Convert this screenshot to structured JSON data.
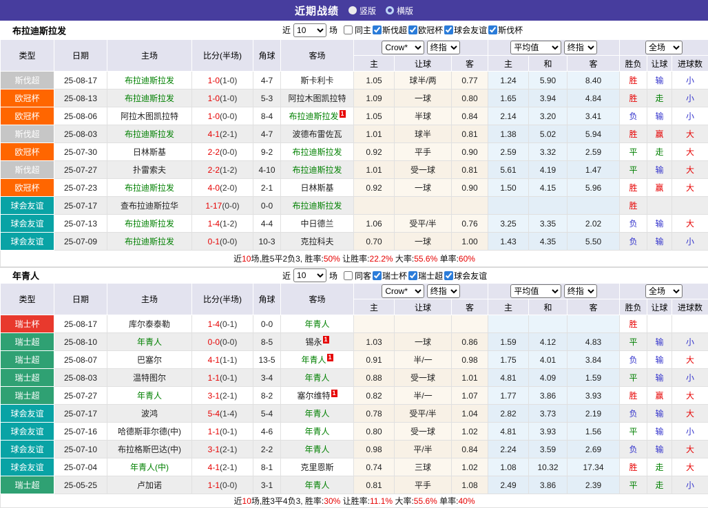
{
  "title_bar": {
    "title": "近期战绩",
    "radio_options": [
      "竖版",
      "横版"
    ],
    "selected_option": "竖版"
  },
  "colors": {
    "titlebar_bg": "#473d9e",
    "accent_red": "#e60000",
    "accent_green": "#008000",
    "accent_blue": "#3333cc",
    "checkbox_blue": "#2b7cd9",
    "header_bg": "#e3e3ef",
    "stripe_gray": "#ededed",
    "odds_col_bg": "#fcf7ee",
    "avg_col_bg": "#eaf4fb",
    "league_colors": {
      "斯伐超": "#c6c6c6",
      "欧冠杯": "#ff6600",
      "球会友谊": "#09a3a5",
      "瑞士杯": "#e8392d",
      "瑞士超": "#2fa173"
    }
  },
  "table_header": {
    "col_type": "类型",
    "col_date": "日期",
    "col_home": "主场",
    "col_score": "比分(半场)",
    "col_corner": "角球",
    "col_away": "客场",
    "odds_source_select": "Crow*",
    "odds_final_select": "终指",
    "avg_select": "平均值",
    "avg_final_select": "终指",
    "scope_select": "全场",
    "sub_cols": [
      "主",
      "让球",
      "客",
      "主",
      "和",
      "客",
      "胜负",
      "让球",
      "进球数"
    ]
  },
  "filter_labels": {
    "near": "近",
    "games": "场",
    "count_value": "10"
  },
  "tables": [
    {
      "team": "布拉迪斯拉发",
      "same_filter": "同主",
      "same_checked": false,
      "league_filters": [
        "斯伐超",
        "欧冠杯",
        "球会友谊",
        "斯伐杯"
      ],
      "rows": [
        {
          "league": "斯伐超",
          "date": "25-08-17",
          "home": "布拉迪斯拉发",
          "home_focus": true,
          "home_mark": "",
          "score": "1-0",
          "half": "(1-0)",
          "corner": "4-7",
          "away": "斯卡利卡",
          "away_focus": false,
          "away_mark": "",
          "odds": [
            "1.05",
            "球半/两",
            "0.77"
          ],
          "avg": [
            "1.24",
            "5.90",
            "8.40"
          ],
          "results": [
            {
              "t": "胜",
              "c": "r"
            },
            {
              "t": "输",
              "c": "b"
            },
            {
              "t": "小",
              "c": "b"
            }
          ]
        },
        {
          "league": "欧冠杯",
          "date": "25-08-13",
          "home": "布拉迪斯拉发",
          "home_focus": true,
          "home_mark": "",
          "score": "1-0",
          "half": "(1-0)",
          "corner": "5-3",
          "away": "阿拉木图凯拉特",
          "away_focus": false,
          "away_mark": "",
          "odds": [
            "1.09",
            "一球",
            "0.80"
          ],
          "avg": [
            "1.65",
            "3.94",
            "4.84"
          ],
          "results": [
            {
              "t": "胜",
              "c": "r"
            },
            {
              "t": "走",
              "c": "g"
            },
            {
              "t": "小",
              "c": "b"
            }
          ]
        },
        {
          "league": "欧冠杯",
          "date": "25-08-06",
          "home": "阿拉木图凯拉特",
          "home_focus": false,
          "home_mark": "",
          "score": "1-0",
          "half": "(0-0)",
          "corner": "8-4",
          "away": "布拉迪斯拉发",
          "away_focus": true,
          "away_mark": "1",
          "odds": [
            "1.05",
            "半球",
            "0.84"
          ],
          "avg": [
            "2.14",
            "3.20",
            "3.41"
          ],
          "results": [
            {
              "t": "负",
              "c": "b"
            },
            {
              "t": "输",
              "c": "b"
            },
            {
              "t": "小",
              "c": "b"
            }
          ]
        },
        {
          "league": "斯伐超",
          "date": "25-08-03",
          "home": "布拉迪斯拉发",
          "home_focus": true,
          "home_mark": "",
          "score": "4-1",
          "half": "(2-1)",
          "corner": "4-7",
          "away": "波德布雷佐瓦",
          "away_focus": false,
          "away_mark": "",
          "odds": [
            "1.01",
            "球半",
            "0.81"
          ],
          "avg": [
            "1.38",
            "5.02",
            "5.94"
          ],
          "results": [
            {
              "t": "胜",
              "c": "r"
            },
            {
              "t": "赢",
              "c": "r"
            },
            {
              "t": "大",
              "c": "r"
            }
          ]
        },
        {
          "league": "欧冠杯",
          "date": "25-07-30",
          "home": "日林斯基",
          "home_focus": false,
          "home_mark": "",
          "score": "2-2",
          "half": "(0-0)",
          "corner": "9-2",
          "away": "布拉迪斯拉发",
          "away_focus": true,
          "away_mark": "",
          "odds": [
            "0.92",
            "平手",
            "0.90"
          ],
          "avg": [
            "2.59",
            "3.32",
            "2.59"
          ],
          "results": [
            {
              "t": "平",
              "c": "g"
            },
            {
              "t": "走",
              "c": "g"
            },
            {
              "t": "大",
              "c": "r"
            }
          ]
        },
        {
          "league": "斯伐超",
          "date": "25-07-27",
          "home": "扑雷索夫",
          "home_focus": false,
          "home_mark": "",
          "score": "2-2",
          "half": "(1-2)",
          "corner": "4-10",
          "away": "布拉迪斯拉发",
          "away_focus": true,
          "away_mark": "",
          "odds": [
            "1.01",
            "受一球",
            "0.81"
          ],
          "avg": [
            "5.61",
            "4.19",
            "1.47"
          ],
          "results": [
            {
              "t": "平",
              "c": "g"
            },
            {
              "t": "输",
              "c": "b"
            },
            {
              "t": "大",
              "c": "r"
            }
          ]
        },
        {
          "league": "欧冠杯",
          "date": "25-07-23",
          "home": "布拉迪斯拉发",
          "home_focus": true,
          "home_mark": "",
          "score": "4-0",
          "half": "(2-0)",
          "corner": "2-1",
          "away": "日林斯基",
          "away_focus": false,
          "away_mark": "",
          "odds": [
            "0.92",
            "一球",
            "0.90"
          ],
          "avg": [
            "1.50",
            "4.15",
            "5.96"
          ],
          "results": [
            {
              "t": "胜",
              "c": "r"
            },
            {
              "t": "赢",
              "c": "r"
            },
            {
              "t": "大",
              "c": "r"
            }
          ]
        },
        {
          "league": "球会友谊",
          "date": "25-07-17",
          "home": "查布拉迪斯拉华",
          "home_focus": false,
          "home_mark": "",
          "score": "1-17",
          "half": "(0-0)",
          "corner": "0-0",
          "away": "布拉迪斯拉发",
          "away_focus": true,
          "away_mark": "",
          "odds": [
            "",
            "",
            ""
          ],
          "avg": [
            "",
            "",
            ""
          ],
          "results": [
            {
              "t": "胜",
              "c": "r"
            },
            {
              "t": "",
              "c": ""
            },
            {
              "t": "",
              "c": ""
            }
          ]
        },
        {
          "league": "球会友谊",
          "date": "25-07-13",
          "home": "布拉迪斯拉发",
          "home_focus": true,
          "home_mark": "",
          "score": "1-4",
          "half": "(1-2)",
          "corner": "4-4",
          "away": "中日德兰",
          "away_focus": false,
          "away_mark": "",
          "odds": [
            "1.06",
            "受平/半",
            "0.76"
          ],
          "avg": [
            "3.25",
            "3.35",
            "2.02"
          ],
          "results": [
            {
              "t": "负",
              "c": "b"
            },
            {
              "t": "输",
              "c": "b"
            },
            {
              "t": "大",
              "c": "r"
            }
          ]
        },
        {
          "league": "球会友谊",
          "date": "25-07-09",
          "home": "布拉迪斯拉发",
          "home_focus": true,
          "home_mark": "",
          "score": "0-1",
          "half": "(0-0)",
          "corner": "10-3",
          "away": "克拉科夫",
          "away_focus": false,
          "away_mark": "",
          "odds": [
            "0.70",
            "一球",
            "1.00"
          ],
          "avg": [
            "1.43",
            "4.35",
            "5.50"
          ],
          "results": [
            {
              "t": "负",
              "c": "b"
            },
            {
              "t": "输",
              "c": "b"
            },
            {
              "t": "小",
              "c": "b"
            }
          ]
        }
      ],
      "summary": [
        {
          "text": "近",
          "red": false
        },
        {
          "text": "10",
          "red": true
        },
        {
          "text": "场,胜5平2负3, 胜率:",
          "red": false
        },
        {
          "text": "50%",
          "red": true
        },
        {
          "text": " 让胜率:",
          "red": false
        },
        {
          "text": "22.2%",
          "red": true
        },
        {
          "text": " 大率:",
          "red": false
        },
        {
          "text": "55.6%",
          "red": true
        },
        {
          "text": " 单率:",
          "red": false
        },
        {
          "text": "60%",
          "red": true
        }
      ]
    },
    {
      "team": "年青人",
      "same_filter": "同客",
      "same_checked": false,
      "league_filters": [
        "瑞士杯",
        "瑞士超",
        "球会友谊"
      ],
      "rows": [
        {
          "league": "瑞士杯",
          "date": "25-08-17",
          "home": "库尔泰泰勒",
          "home_focus": false,
          "home_mark": "",
          "score": "1-4",
          "half": "(0-1)",
          "corner": "0-0",
          "away": "年青人",
          "away_focus": true,
          "away_mark": "",
          "odds": [
            "",
            "",
            ""
          ],
          "avg": [
            "",
            "",
            ""
          ],
          "results": [
            {
              "t": "胜",
              "c": "r"
            },
            {
              "t": "",
              "c": ""
            },
            {
              "t": "",
              "c": ""
            }
          ]
        },
        {
          "league": "瑞士超",
          "date": "25-08-10",
          "home": "年青人",
          "home_focus": true,
          "home_mark": "",
          "score": "0-0",
          "half": "(0-0)",
          "corner": "8-5",
          "away": "锡永",
          "away_focus": false,
          "away_mark": "1",
          "odds": [
            "1.03",
            "一球",
            "0.86"
          ],
          "avg": [
            "1.59",
            "4.12",
            "4.83"
          ],
          "results": [
            {
              "t": "平",
              "c": "g"
            },
            {
              "t": "输",
              "c": "b"
            },
            {
              "t": "小",
              "c": "b"
            }
          ]
        },
        {
          "league": "瑞士超",
          "date": "25-08-07",
          "home": "巴塞尔",
          "home_focus": false,
          "home_mark": "",
          "score": "4-1",
          "half": "(1-1)",
          "corner": "13-5",
          "away": "年青人",
          "away_focus": true,
          "away_mark": "1",
          "odds": [
            "0.91",
            "半/一",
            "0.98"
          ],
          "avg": [
            "1.75",
            "4.01",
            "3.84"
          ],
          "results": [
            {
              "t": "负",
              "c": "b"
            },
            {
              "t": "输",
              "c": "b"
            },
            {
              "t": "大",
              "c": "r"
            }
          ]
        },
        {
          "league": "瑞士超",
          "date": "25-08-03",
          "home": "温特图尔",
          "home_focus": false,
          "home_mark": "",
          "score": "1-1",
          "half": "(0-1)",
          "corner": "3-4",
          "away": "年青人",
          "away_focus": true,
          "away_mark": "",
          "odds": [
            "0.88",
            "受一球",
            "1.01"
          ],
          "avg": [
            "4.81",
            "4.09",
            "1.59"
          ],
          "results": [
            {
              "t": "平",
              "c": "g"
            },
            {
              "t": "输",
              "c": "b"
            },
            {
              "t": "小",
              "c": "b"
            }
          ]
        },
        {
          "league": "瑞士超",
          "date": "25-07-27",
          "home": "年青人",
          "home_focus": true,
          "home_mark": "",
          "score": "3-1",
          "half": "(2-1)",
          "corner": "8-2",
          "away": "塞尔维特",
          "away_focus": false,
          "away_mark": "1",
          "odds": [
            "0.82",
            "半/一",
            "1.07"
          ],
          "avg": [
            "1.77",
            "3.86",
            "3.93"
          ],
          "results": [
            {
              "t": "胜",
              "c": "r"
            },
            {
              "t": "赢",
              "c": "r"
            },
            {
              "t": "大",
              "c": "r"
            }
          ]
        },
        {
          "league": "球会友谊",
          "date": "25-07-17",
          "home": "波鸿",
          "home_focus": false,
          "home_mark": "",
          "score": "5-4",
          "half": "(1-4)",
          "corner": "5-4",
          "away": "年青人",
          "away_focus": true,
          "away_mark": "",
          "odds": [
            "0.78",
            "受平/半",
            "1.04"
          ],
          "avg": [
            "2.82",
            "3.73",
            "2.19"
          ],
          "results": [
            {
              "t": "负",
              "c": "b"
            },
            {
              "t": "输",
              "c": "b"
            },
            {
              "t": "大",
              "c": "r"
            }
          ]
        },
        {
          "league": "球会友谊",
          "date": "25-07-16",
          "home": "哈德斯菲尔德(中)",
          "home_focus": false,
          "home_mark": "",
          "score": "1-1",
          "half": "(0-1)",
          "corner": "4-6",
          "away": "年青人",
          "away_focus": true,
          "away_mark": "",
          "odds": [
            "0.80",
            "受一球",
            "1.02"
          ],
          "avg": [
            "4.81",
            "3.93",
            "1.56"
          ],
          "results": [
            {
              "t": "平",
              "c": "g"
            },
            {
              "t": "输",
              "c": "b"
            },
            {
              "t": "小",
              "c": "b"
            }
          ]
        },
        {
          "league": "球会友谊",
          "date": "25-07-10",
          "home": "布拉格斯巴达(中)",
          "home_focus": false,
          "home_mark": "",
          "score": "3-1",
          "half": "(2-1)",
          "corner": "2-2",
          "away": "年青人",
          "away_focus": true,
          "away_mark": "",
          "odds": [
            "0.98",
            "平/半",
            "0.84"
          ],
          "avg": [
            "2.24",
            "3.59",
            "2.69"
          ],
          "results": [
            {
              "t": "负",
              "c": "b"
            },
            {
              "t": "输",
              "c": "b"
            },
            {
              "t": "大",
              "c": "r"
            }
          ]
        },
        {
          "league": "球会友谊",
          "date": "25-07-04",
          "home": "年青人(中)",
          "home_focus": true,
          "home_mark": "",
          "score": "4-1",
          "half": "(2-1)",
          "corner": "8-1",
          "away": "克里恩斯",
          "away_focus": false,
          "away_mark": "",
          "odds": [
            "0.74",
            "三球",
            "1.02"
          ],
          "avg": [
            "1.08",
            "10.32",
            "17.34"
          ],
          "results": [
            {
              "t": "胜",
              "c": "r"
            },
            {
              "t": "走",
              "c": "g"
            },
            {
              "t": "大",
              "c": "r"
            }
          ]
        },
        {
          "league": "瑞士超",
          "date": "25-05-25",
          "home": "卢加诺",
          "home_focus": false,
          "home_mark": "",
          "score": "1-1",
          "half": "(0-0)",
          "corner": "3-1",
          "away": "年青人",
          "away_focus": true,
          "away_mark": "",
          "odds": [
            "0.81",
            "平手",
            "1.08"
          ],
          "avg": [
            "2.49",
            "3.86",
            "2.39"
          ],
          "results": [
            {
              "t": "平",
              "c": "g"
            },
            {
              "t": "走",
              "c": "g"
            },
            {
              "t": "小",
              "c": "b"
            }
          ]
        }
      ],
      "summary": [
        {
          "text": "近",
          "red": false
        },
        {
          "text": "10",
          "red": true
        },
        {
          "text": "场,胜3平4负3, 胜率:",
          "red": false
        },
        {
          "text": "30%",
          "red": true
        },
        {
          "text": " 让胜率:",
          "red": false
        },
        {
          "text": "11.1%",
          "red": true
        },
        {
          "text": " 大率:",
          "red": false
        },
        {
          "text": "55.6%",
          "red": true
        },
        {
          "text": " 单率:",
          "red": false
        },
        {
          "text": "40%",
          "red": true
        }
      ]
    }
  ]
}
